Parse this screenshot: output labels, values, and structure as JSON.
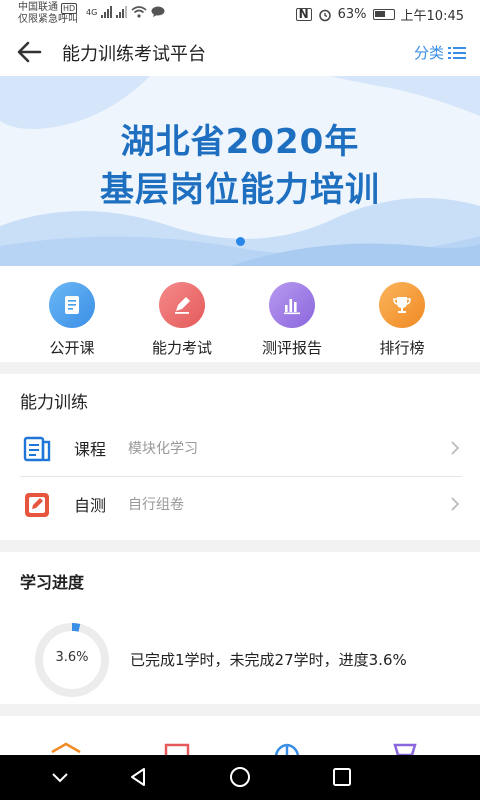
{
  "status_bar": {
    "carrier": "中国联通",
    "hd_badge": "HD",
    "emergency": "仅限紧急呼叫",
    "signal_badge": "4G",
    "battery": "63%",
    "time": "上午10:45"
  },
  "header": {
    "title": "能力训练考试平台",
    "classify_label": "分类"
  },
  "banner": {
    "line1": "湖北省2020年",
    "line2": "基层岗位能力培训"
  },
  "quick_menu": [
    {
      "label": "公开课",
      "icon": "document-icon",
      "color": "#4a9fe8"
    },
    {
      "label": "能力考试",
      "icon": "pen-icon",
      "color": "#ee6a6a"
    },
    {
      "label": "测评报告",
      "icon": "bar-chart-icon",
      "color": "#9b7be6"
    },
    {
      "label": "排行榜",
      "icon": "trophy-icon",
      "color": "#f59a3a"
    }
  ],
  "training": {
    "title": "能力训练",
    "items": [
      {
        "name": "课程",
        "sub": "模块化学习",
        "icon": "book-icon"
      },
      {
        "name": "自测",
        "sub": "自行组卷",
        "icon": "edit-icon"
      }
    ]
  },
  "progress": {
    "title": "学习进度",
    "percent_label": "3.6%",
    "percent_value": 3.6,
    "summary": "已完成1学时，未完成27学时，进度3.6%"
  },
  "colors": {
    "accent": "#3a8ee6",
    "banner_text": "#1f6fc0"
  }
}
